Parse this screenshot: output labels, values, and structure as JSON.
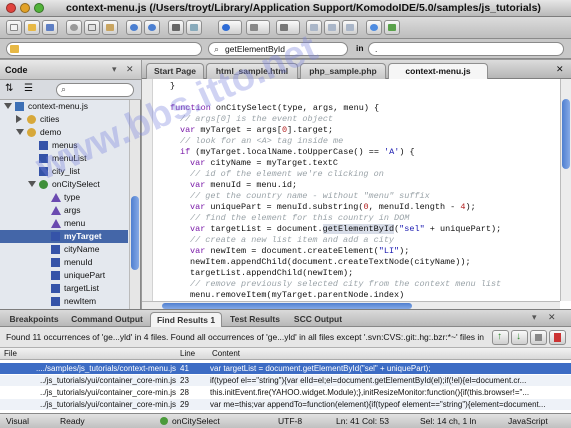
{
  "window": {
    "title": "context-menu.js (/Users/troyt/Library/Application Support/KomodoIDE/5.0/samples/js_tutorials)"
  },
  "search_bar": {
    "query": "getElementById",
    "in_label": "in",
    "scope": "."
  },
  "left_pane": {
    "title": "Code"
  },
  "tree": [
    {
      "label": "context-menu.js",
      "depth": 0,
      "icon": "js-file-icon",
      "open": true
    },
    {
      "label": "cities",
      "depth": 1,
      "icon": "namespace-icon",
      "open": false
    },
    {
      "label": "demo",
      "depth": 1,
      "icon": "namespace-icon",
      "open": true
    },
    {
      "label": "menus",
      "depth": 2,
      "icon": "variable-icon"
    },
    {
      "label": "menuList",
      "depth": 2,
      "icon": "variable-icon"
    },
    {
      "label": "city_list",
      "depth": 2,
      "icon": "variable-icon"
    },
    {
      "label": "onCitySelect",
      "depth": 2,
      "icon": "function-icon",
      "open": true
    },
    {
      "label": "type",
      "depth": 3,
      "icon": "argument-icon"
    },
    {
      "label": "args",
      "depth": 3,
      "icon": "argument-icon"
    },
    {
      "label": "menu",
      "depth": 3,
      "icon": "argument-icon"
    },
    {
      "label": "myTarget",
      "depth": 3,
      "icon": "variable-icon",
      "selected": true
    },
    {
      "label": "cityName",
      "depth": 3,
      "icon": "variable-icon"
    },
    {
      "label": "menuId",
      "depth": 3,
      "icon": "variable-icon"
    },
    {
      "label": "uniquePart",
      "depth": 3,
      "icon": "variable-icon"
    },
    {
      "label": "targetList",
      "depth": 3,
      "icon": "variable-icon"
    },
    {
      "label": "newItem",
      "depth": 3,
      "icon": "variable-icon"
    }
  ],
  "editor_tabs": [
    {
      "label": "Start Page"
    },
    {
      "label": "html_sample.html"
    },
    {
      "label": "php_sample.php"
    },
    {
      "label": "context-menu.js",
      "active": true
    }
  ],
  "code_lines": [
    {
      "text": "}",
      "style": "plain",
      "indent": 2
    },
    {
      "text": "",
      "style": "plain",
      "indent": 0
    },
    {
      "text": "function onCitySelect(type, args, menu) {",
      "style": "kw",
      "indent": 2
    },
    {
      "text": "// args[0] is the event object",
      "style": "comment",
      "indent": 4
    },
    {
      "text": "var myTarget = args[0].target;",
      "style": "kw",
      "indent": 4
    },
    {
      "text": "// look for an <A> tag inside me",
      "style": "comment",
      "indent": 4
    },
    {
      "text": "if (myTarget.localName.toUpperCase() == 'A') {",
      "style": "kw",
      "indent": 4
    },
    {
      "text": "var cityName = myTarget.textC",
      "style": "kw",
      "indent": 6
    },
    {
      "text": "// id of the element we're clicking on",
      "style": "comment",
      "indent": 6
    },
    {
      "text": "var menuId = menu.id;",
      "style": "kw",
      "indent": 6
    },
    {
      "text": "// get the country name - without \"menu\" suffix",
      "style": "comment",
      "indent": 6
    },
    {
      "text": "var uniquePart = menuId.substring(0, menuId.length - 4);",
      "style": "kw",
      "indent": 6
    },
    {
      "text": "// find the element for this country in DOM",
      "style": "comment",
      "indent": 6
    },
    {
      "text": "var targetList = document.getElementById(\"sel\" + uniquePart);",
      "style": "highlight",
      "indent": 6
    },
    {
      "text": "// create a new list item and add a city",
      "style": "comment",
      "indent": 6
    },
    {
      "text": "var newItem = document.createElement(\"LI\");",
      "style": "kw",
      "indent": 6
    },
    {
      "text": "newItem.appendChild(document.createTextNode(cityName));",
      "style": "plain",
      "indent": 6
    },
    {
      "text": "targetList.appendChild(newItem);",
      "style": "plain",
      "indent": 6
    },
    {
      "text": "// remove previously selected city from the context menu list",
      "style": "comment",
      "indent": 6
    },
    {
      "text": "menu.removeItem(myTarget.parentNode.index)",
      "style": "plain",
      "indent": 6
    }
  ],
  "bottom_tabs": [
    {
      "label": "Breakpoints"
    },
    {
      "label": "Command Output"
    },
    {
      "label": "Find Results 1",
      "active": true
    },
    {
      "label": "Test Results"
    },
    {
      "label": "SCC Output"
    }
  ],
  "find_results": {
    "summary": "Found 11 occurrences of 'ge...yld' in 4 files. Found all occurrences of 'ge...yld' in all files except '.svn:CVS:.git:.hg:.bzr:*~' files in '.'.",
    "columns": {
      "file": "File",
      "line": "Line",
      "content": "Content"
    },
    "rows": [
      {
        "file": "..../samples/js_tutorials/context-menu.js",
        "line": "41",
        "content": "var targetList = document.getElementById(\"sel\" + uniquePart);",
        "selected": true
      },
      {
        "file": "../js_tutorials/yui/container_core-min.js",
        "line": "23",
        "content": "if(typeof el==\"string\"){var elId=el;el=document.getElementById(el);if(!el){el=document.cr..."
      },
      {
        "file": "../js_tutorials/yui/container_core-min.js",
        "line": "28",
        "content": "this.initEvent.fire(YAHOO.widget.Module);},initResizeMonitor:function(){if(this.browser!=\"..."
      },
      {
        "file": "../js_tutorials/yui/container_core-min.js",
        "line": "29",
        "content": "var me=this;var appendTo=function(element){if(typeof element==\"string\"){element=document..."
      }
    ]
  },
  "status": {
    "mode": "Visual",
    "state": "Ready",
    "symbol": "onCitySelect",
    "encoding": "UTF-8",
    "position": "Ln: 41 Col: 53",
    "selection": "Sel: 14 ch, 1 ln",
    "language": "JavaScript"
  },
  "watermark": "www.bbs.itto.net"
}
